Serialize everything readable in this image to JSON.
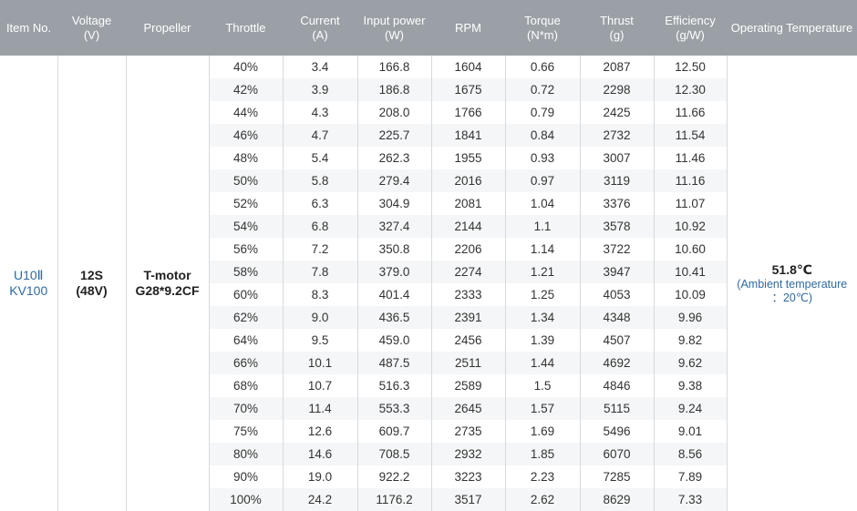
{
  "headers": [
    {
      "line1": "Item No.",
      "line2": ""
    },
    {
      "line1": "Voltage",
      "line2": "(V)"
    },
    {
      "line1": "Propeller",
      "line2": ""
    },
    {
      "line1": "Throttle",
      "line2": ""
    },
    {
      "line1": "Current",
      "line2": "(A)"
    },
    {
      "line1": "Input power",
      "line2": "(W)"
    },
    {
      "line1": "RPM",
      "line2": ""
    },
    {
      "line1": "Torque",
      "line2": "(N*m)"
    },
    {
      "line1": "Thrust",
      "line2": "(g)"
    },
    {
      "line1": "Efficiency",
      "line2": "(g/W)"
    },
    {
      "line1": "Operating Temperature",
      "line2": ""
    }
  ],
  "item": {
    "line1": "U10Ⅱ",
    "line2": "KV100"
  },
  "voltage": {
    "line1": "12S",
    "line2": "(48V)"
  },
  "propeller": {
    "line1": "T-motor",
    "line2": "G28*9.2CF"
  },
  "temperature": {
    "main": "51.8℃",
    "sub1": "(Ambient temperature",
    "sub2": "：20℃)"
  },
  "rows": [
    [
      "40%",
      "3.4",
      "166.8",
      "1604",
      "0.66",
      "2087",
      "12.50"
    ],
    [
      "42%",
      "3.9",
      "186.8",
      "1675",
      "0.72",
      "2298",
      "12.30"
    ],
    [
      "44%",
      "4.3",
      "208.0",
      "1766",
      "0.79",
      "2425",
      "11.66"
    ],
    [
      "46%",
      "4.7",
      "225.7",
      "1841",
      "0.84",
      "2732",
      "11.54"
    ],
    [
      "48%",
      "5.4",
      "262.3",
      "1955",
      "0.93",
      "3007",
      "11.46"
    ],
    [
      "50%",
      "5.8",
      "279.4",
      "2016",
      "0.97",
      "3119",
      "11.16"
    ],
    [
      "52%",
      "6.3",
      "304.9",
      "2081",
      "1.04",
      "3376",
      "11.07"
    ],
    [
      "54%",
      "6.8",
      "327.4",
      "2144",
      "1.1",
      "3578",
      "10.92"
    ],
    [
      "56%",
      "7.2",
      "350.8",
      "2206",
      "1.14",
      "3722",
      "10.60"
    ],
    [
      "58%",
      "7.8",
      "379.0",
      "2274",
      "1.21",
      "3947",
      "10.41"
    ],
    [
      "60%",
      "8.3",
      "401.4",
      "2333",
      "1.25",
      "4053",
      "10.09"
    ],
    [
      "62%",
      "9.0",
      "436.5",
      "2391",
      "1.34",
      "4348",
      "9.96"
    ],
    [
      "64%",
      "9.5",
      "459.0",
      "2456",
      "1.39",
      "4507",
      "9.82"
    ],
    [
      "66%",
      "10.1",
      "487.5",
      "2511",
      "1.44",
      "4692",
      "9.62"
    ],
    [
      "68%",
      "10.7",
      "516.3",
      "2589",
      "1.5",
      "4846",
      "9.38"
    ],
    [
      "70%",
      "11.4",
      "553.3",
      "2645",
      "1.57",
      "5115",
      "9.24"
    ],
    [
      "75%",
      "12.6",
      "609.7",
      "2735",
      "1.69",
      "5496",
      "9.01"
    ],
    [
      "80%",
      "14.6",
      "708.5",
      "2932",
      "1.85",
      "6070",
      "8.56"
    ],
    [
      "90%",
      "19.0",
      "922.2",
      "3223",
      "2.23",
      "7285",
      "7.89"
    ],
    [
      "100%",
      "24.2",
      "1176.2",
      "3517",
      "2.62",
      "8629",
      "7.33"
    ]
  ]
}
